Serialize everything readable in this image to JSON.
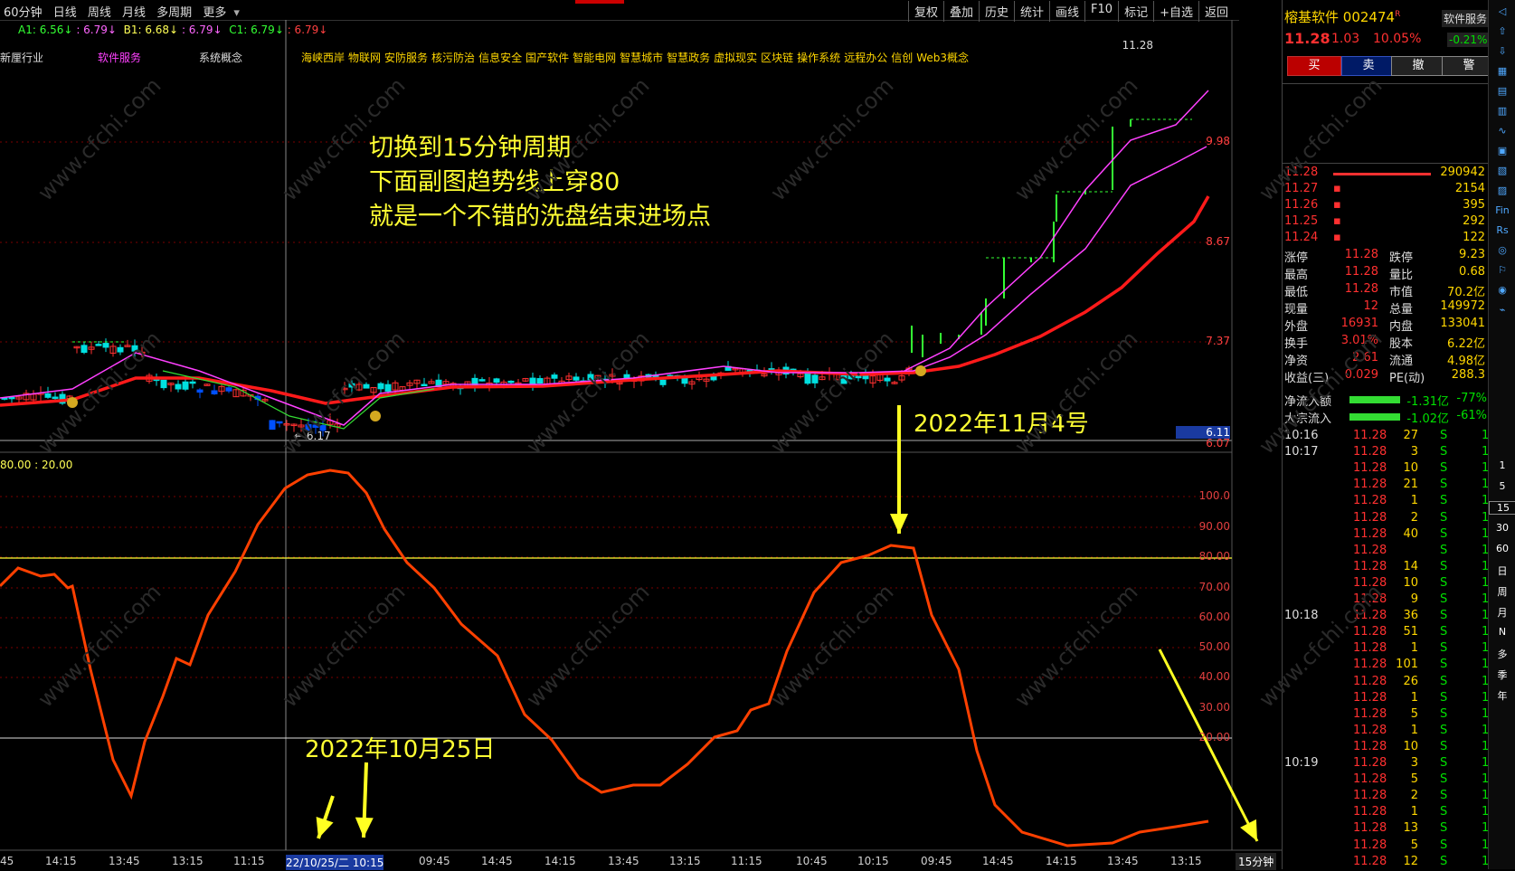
{
  "toolbar": {
    "period": "60分钟",
    "day": "日线",
    "week": "周线",
    "month": "月线",
    "multi": "多周期",
    "more": "更多",
    "right": [
      "复权",
      "叠加",
      "历史",
      "统计",
      "画线",
      "F10",
      "标记",
      "+自选",
      "返回"
    ]
  },
  "indicators": {
    "a1": "A1: 6.56",
    "a1c": ": 6.79",
    "b1": "B1: 6.68",
    "b1c": ": 6.79",
    "c1": "C1: 6.79",
    "c1c": ": 6.79"
  },
  "info": {
    "industry": "新厘行业",
    "sector": "软件服务",
    "concept": "系统概念",
    "concepts": [
      "海峡西岸",
      "物联网",
      "安防服务",
      "核污防治",
      "信息安全",
      "国产软件",
      "智能电网",
      "智慧城市",
      "智慧政务",
      "虚拟现实",
      "区块链",
      "操作系统",
      "远程办公",
      "信创",
      "Web3概念"
    ]
  },
  "main_axis": [
    "9.98",
    "8.67",
    "7.37",
    "6.11",
    "6.07"
  ],
  "peak_label": "11.28",
  "low_label": "6.17",
  "sub_header": "80.00 : 20.00",
  "sub_axis": [
    "100.0",
    "90.00",
    "80.00",
    "70.00",
    "60.00",
    "50.00",
    "40.00",
    "30.00",
    "20.00"
  ],
  "x_axis": [
    "45",
    "14:15",
    "13:45",
    "13:15",
    "11:15",
    "22/10/25/二 10:15",
    "09:45",
    "14:45",
    "14:15",
    "13:45",
    "13:15",
    "11:15",
    "10:45",
    "10:15",
    "09:45",
    "14:45",
    "14:15",
    "13:45",
    "13:15"
  ],
  "period_label": "15分钟",
  "annotations": {
    "line1": "切换到15分钟周期",
    "line2": "下面副图趋势线上穿80",
    "line3": "就是一个不错的洗盘结束进场点",
    "date1": "2022年11月4号",
    "date2": "2022年10月25日"
  },
  "stock": {
    "name": "榕基软件",
    "code": "002474",
    "flag": "R",
    "price": "11.28",
    "change": "1.03",
    "pct": "10.05%",
    "sector": "软件服务",
    "sector_pct": "-0.21%"
  },
  "trade_buttons": [
    "买",
    "卖",
    "撤",
    "警"
  ],
  "orderbook": [
    {
      "p": "11.28",
      "v": "290942"
    },
    {
      "p": "11.27",
      "v": "2154"
    },
    {
      "p": "11.26",
      "v": "395"
    },
    {
      "p": "11.25",
      "v": "292"
    },
    {
      "p": "11.24",
      "v": "122"
    }
  ],
  "quote": [
    [
      "涨停",
      "11.28",
      "跌停",
      "9.23"
    ],
    [
      "最高",
      "11.28",
      "量比",
      "0.68"
    ],
    [
      "最低",
      "11.28",
      "市值",
      "70.2亿"
    ],
    [
      "现量",
      "12",
      "总量",
      "149972"
    ],
    [
      "外盘",
      "16931",
      "内盘",
      "133041"
    ],
    [
      "换手",
      "3.01%",
      "股本",
      "6.22亿"
    ],
    [
      "净资",
      "2.61",
      "流通",
      "4.98亿"
    ],
    [
      "收益(三)",
      "0.029",
      "PE(动)",
      "288.3"
    ]
  ],
  "flow": [
    {
      "l": "净流入额",
      "v": "-1.31亿",
      "p": "-77%"
    },
    {
      "l": "大宗流入",
      "v": "-1.02亿",
      "p": "-61%"
    }
  ],
  "ticks": [
    {
      "t": "10:16",
      "p": "11.28",
      "v": "27",
      "s": "S"
    },
    {
      "t": "10:17",
      "p": "11.28",
      "v": "3",
      "s": "S"
    },
    {
      "t": "",
      "p": "11.28",
      "v": "10",
      "s": "S"
    },
    {
      "t": "",
      "p": "11.28",
      "v": "21",
      "s": "S"
    },
    {
      "t": "",
      "p": "11.28",
      "v": "1",
      "s": "S"
    },
    {
      "t": "",
      "p": "11.28",
      "v": "2",
      "s": "S"
    },
    {
      "t": "",
      "p": "11.28",
      "v": "40",
      "s": "S"
    },
    {
      "t": "",
      "p": "11.28",
      "v": "",
      "s": "S"
    },
    {
      "t": "",
      "p": "11.28",
      "v": "14",
      "s": "S"
    },
    {
      "t": "",
      "p": "11.28",
      "v": "10",
      "s": "S"
    },
    {
      "t": "",
      "p": "11.28",
      "v": "9",
      "s": "S"
    },
    {
      "t": "10:18",
      "p": "11.28",
      "v": "36",
      "s": "S"
    },
    {
      "t": "",
      "p": "11.28",
      "v": "51",
      "s": "S"
    },
    {
      "t": "",
      "p": "11.28",
      "v": "1",
      "s": "S"
    },
    {
      "t": "",
      "p": "11.28",
      "v": "101",
      "s": "S"
    },
    {
      "t": "",
      "p": "11.28",
      "v": "26",
      "s": "S"
    },
    {
      "t": "",
      "p": "11.28",
      "v": "1",
      "s": "S"
    },
    {
      "t": "",
      "p": "11.28",
      "v": "5",
      "s": "S"
    },
    {
      "t": "",
      "p": "11.28",
      "v": "1",
      "s": "S"
    },
    {
      "t": "",
      "p": "11.28",
      "v": "10",
      "s": "S"
    },
    {
      "t": "10:19",
      "p": "11.28",
      "v": "3",
      "s": "S"
    },
    {
      "t": "",
      "p": "11.28",
      "v": "5",
      "s": "S"
    },
    {
      "t": "",
      "p": "11.28",
      "v": "2",
      "s": "S"
    },
    {
      "t": "",
      "p": "11.28",
      "v": "1",
      "s": "S"
    },
    {
      "t": "",
      "p": "11.28",
      "v": "13",
      "s": "S"
    },
    {
      "t": "",
      "p": "11.28",
      "v": "5",
      "s": "S"
    },
    {
      "t": "",
      "p": "11.28",
      "v": "12",
      "s": "S"
    }
  ],
  "side_periods": [
    "1",
    "5",
    "15",
    "30",
    "60",
    "日",
    "周",
    "月",
    "N",
    "多",
    "季",
    "年"
  ],
  "watermark": "www.cfchi.com",
  "colors": {
    "up": "#ff3030",
    "down": "#00e0e0",
    "ma_red": "#ff1a1a",
    "ma_purple": "#ff40ff",
    "ma_green": "#33dd33",
    "trend": "#ff4000",
    "level80": "#ffff33"
  }
}
